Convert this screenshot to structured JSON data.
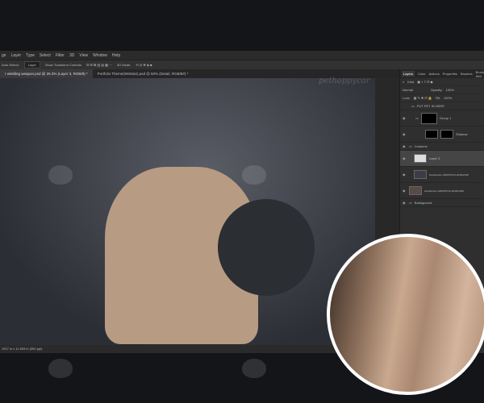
{
  "menu": [
    "ge",
    "Layer",
    "Type",
    "Select",
    "Filter",
    "3D",
    "View",
    "Window",
    "Help"
  ],
  "options": {
    "auto_select": "Auto-Select:",
    "layer_select": "Layer",
    "transform": "Show Transform Controls",
    "mode3d": "3D Mode:"
  },
  "tabs": [
    {
      "label": "r wielding weapon.psd @ 26.3% (Layer 3, RGB/8) *"
    },
    {
      "label": "Portfolio Theme(Website).psd @ 50% (Detail, RGB/8#) *"
    }
  ],
  "status": "1917 in x 11.693 in (300 ppi)",
  "watermark": "pethappycar",
  "panel": {
    "tabs": [
      "Layers",
      "Color",
      "Actions",
      "Properties",
      "Brushes",
      "Brush Sett"
    ],
    "kind": "Kind",
    "blend": "Normal",
    "opacity_label": "Opacity:",
    "opacity": "100%",
    "lock": "Lock:",
    "fill_label": "Fill:",
    "fill": "100%",
    "layers": [
      "PUT PET IN HERE",
      "Group 1",
      "Shadow",
      "Costume",
      "Layer 3",
      "istockphoto-1309979710-2048x2048",
      "istockphoto-1309979710-2048x2048",
      "Background"
    ]
  }
}
